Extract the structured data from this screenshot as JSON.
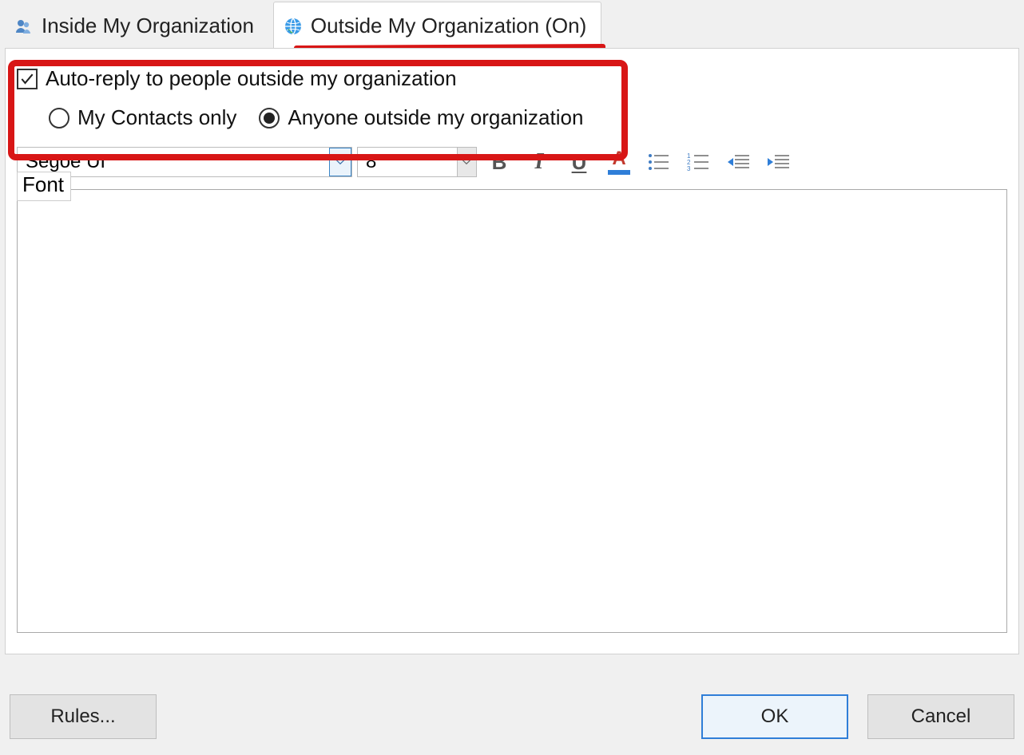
{
  "tabs": {
    "inside": {
      "label": "Inside My Organization"
    },
    "outside": {
      "label": "Outside My Organization (On)"
    }
  },
  "options": {
    "auto_reply_label": "Auto-reply to people outside my organization",
    "auto_reply_checked": true,
    "contacts_only_label": "My Contacts only",
    "anyone_label": "Anyone outside my organization",
    "selected_radio": "anyone"
  },
  "toolbar": {
    "font_value": "Segoe UI",
    "size_value": "8",
    "tooltip": "Font",
    "bold_glyph": "B",
    "italic_glyph": "I",
    "underline_glyph": "U",
    "fontcolor_glyph": "A"
  },
  "footer": {
    "rules_label": "Rules...",
    "ok_label": "OK",
    "cancel_label": "Cancel"
  },
  "colors": {
    "annotation": "#d81616",
    "accent": "#2f7ed8"
  }
}
